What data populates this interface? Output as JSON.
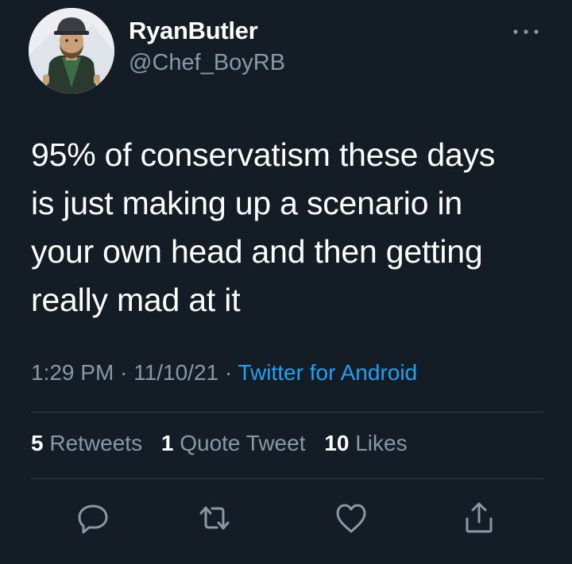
{
  "author": {
    "display_name": "RyanButler",
    "handle": "@Chef_BoyRB",
    "avatar_icon": "avatar-photo",
    "more_icon": "more-options-icon"
  },
  "tweet": {
    "text_lines": [
      "95% of conservatism these days",
      "is just making up a scenario in",
      "your own head and then getting",
      "really mad at it"
    ],
    "time": "1:29 PM",
    "separator": "·",
    "date": "11/10/21",
    "source": "Twitter for Android"
  },
  "stats": {
    "retweets_count": "5",
    "retweets_label": "Retweets",
    "quotes_count": "1",
    "quotes_label": "Quote Tweet",
    "likes_count": "10",
    "likes_label": "Likes"
  },
  "actions": {
    "reply_icon": "reply-icon",
    "retweet_icon": "retweet-icon",
    "like_icon": "like-icon",
    "share_icon": "share-icon"
  },
  "colors": {
    "background": "#141d26",
    "text": "#ffffff",
    "secondary": "#8899a6",
    "link": "#1da1f2",
    "divider": "#2f3b47"
  }
}
